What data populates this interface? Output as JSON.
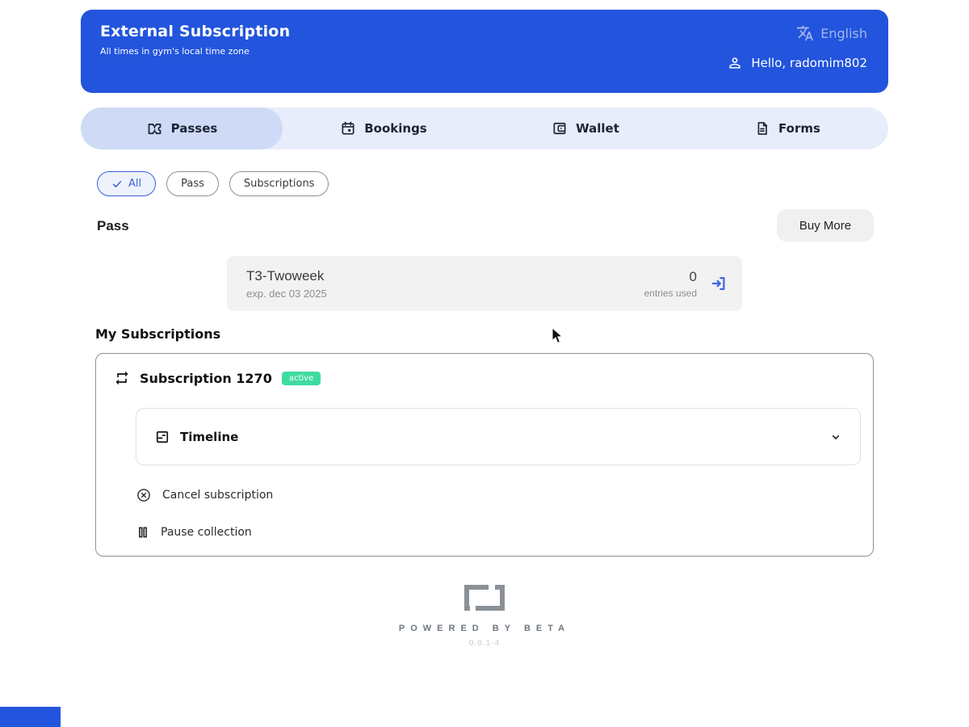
{
  "header": {
    "title": "External Subscription",
    "subtitle": "All times in gym's local time zone",
    "language": "English",
    "greeting": "Hello, radomim802"
  },
  "tabs": [
    {
      "label": "Passes",
      "icon": "ticket-icon",
      "active": true
    },
    {
      "label": "Bookings",
      "icon": "calendar-icon",
      "active": false
    },
    {
      "label": "Wallet",
      "icon": "wallet-icon",
      "active": false
    },
    {
      "label": "Forms",
      "icon": "document-icon",
      "active": false
    }
  ],
  "filters": [
    {
      "label": "All",
      "selected": true,
      "icon": "check-icon"
    },
    {
      "label": "Pass",
      "selected": false
    },
    {
      "label": "Subscriptions",
      "selected": false
    }
  ],
  "pass_section": {
    "heading": "Pass",
    "buy_more_label": "Buy More",
    "passes": [
      {
        "name": "T3-Twoweek",
        "expiry": "exp. dec 03 2025",
        "entries_count": "0",
        "entries_label": "entries used",
        "icon": "login-arrow-icon"
      }
    ]
  },
  "subscriptions_section": {
    "heading": "My Subscriptions",
    "subscriptions": [
      {
        "title": "Subscription 1270",
        "status": "active",
        "icon": "repeat-icon",
        "timeline_label": "Timeline",
        "actions": [
          {
            "label": "Cancel subscription",
            "icon": "cancel-circle-icon"
          },
          {
            "label": "Pause collection",
            "icon": "pause-icon"
          }
        ]
      }
    ]
  },
  "footer": {
    "powered_by": "POWERED BY BETA",
    "version": "0.0.1-4"
  },
  "colors": {
    "primary_blue": "#2254DD",
    "tabbar_bg": "#E7EDFA",
    "tab_active_bg": "#CFDAF6",
    "chip_selected": "#3A62D8",
    "pass_card_bg": "#F2F2F2",
    "enter_arrow_blue": "#3E66E0",
    "active_badge_green": "#3EDBA0",
    "language_text": "#A6B6EA"
  }
}
